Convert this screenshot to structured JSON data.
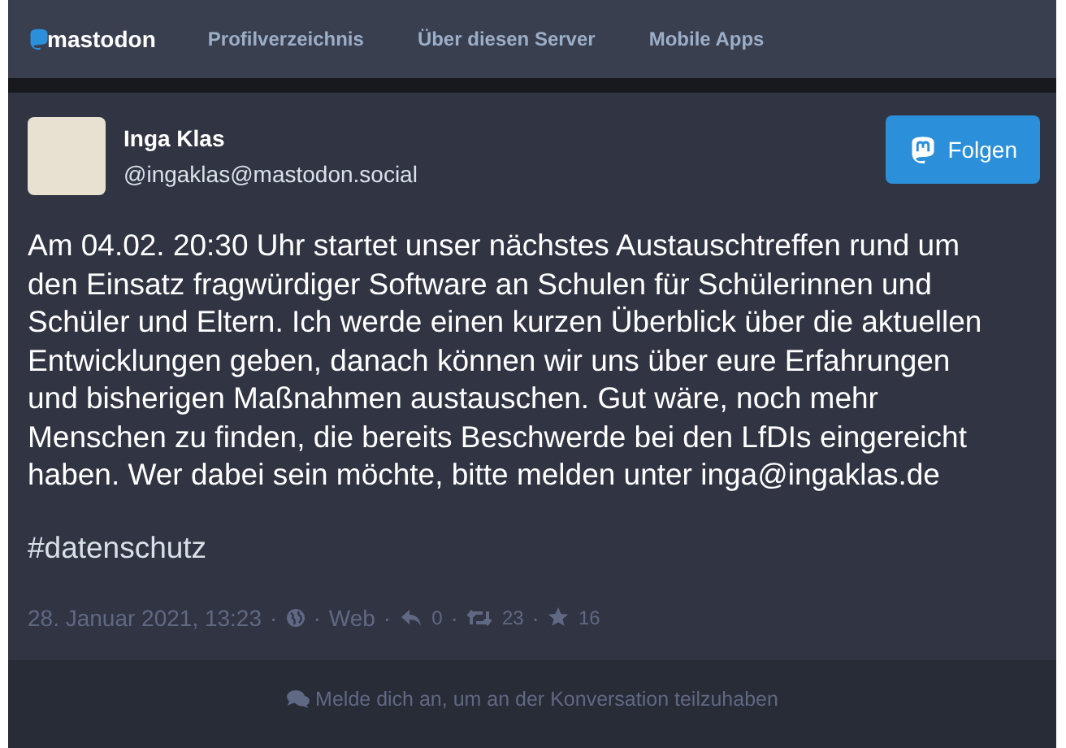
{
  "nav": {
    "logo": "mastodon",
    "links": [
      "Profilverzeichnis",
      "Über diesen Server",
      "Mobile Apps"
    ]
  },
  "status": {
    "display_name": "Inga Klas",
    "account": "@ingaklas@mastodon.social",
    "follow_button": "Folgen",
    "content": "Am 04.02. 20:30 Uhr startet unser nächstes Austauschtreffen rund um den Einsatz fragwürdiger Software an Schulen für Schülerinnen und Schüler und Eltern. Ich werde einen kurzen Überblick über die aktuellen Entwicklungen geben, danach können wir uns über eure Erfahrungen und bisherigen Maßnahmen austauschen. Gut wäre, noch mehr Menschen zu finden, die bereits Beschwerde bei den LfDIs eingereicht haben. Wer dabei sein möchte, bitte melden unter inga@ingaklas.de",
    "hashtag": "#datenschutz",
    "separator": "·",
    "date": "28. Januar 2021, 13:23",
    "application": "Web",
    "replies": "0",
    "boosts": "23",
    "favourites": "16"
  },
  "footer": {
    "prompt": "Melde dich an, um an der Konversation teilzuhaben"
  }
}
